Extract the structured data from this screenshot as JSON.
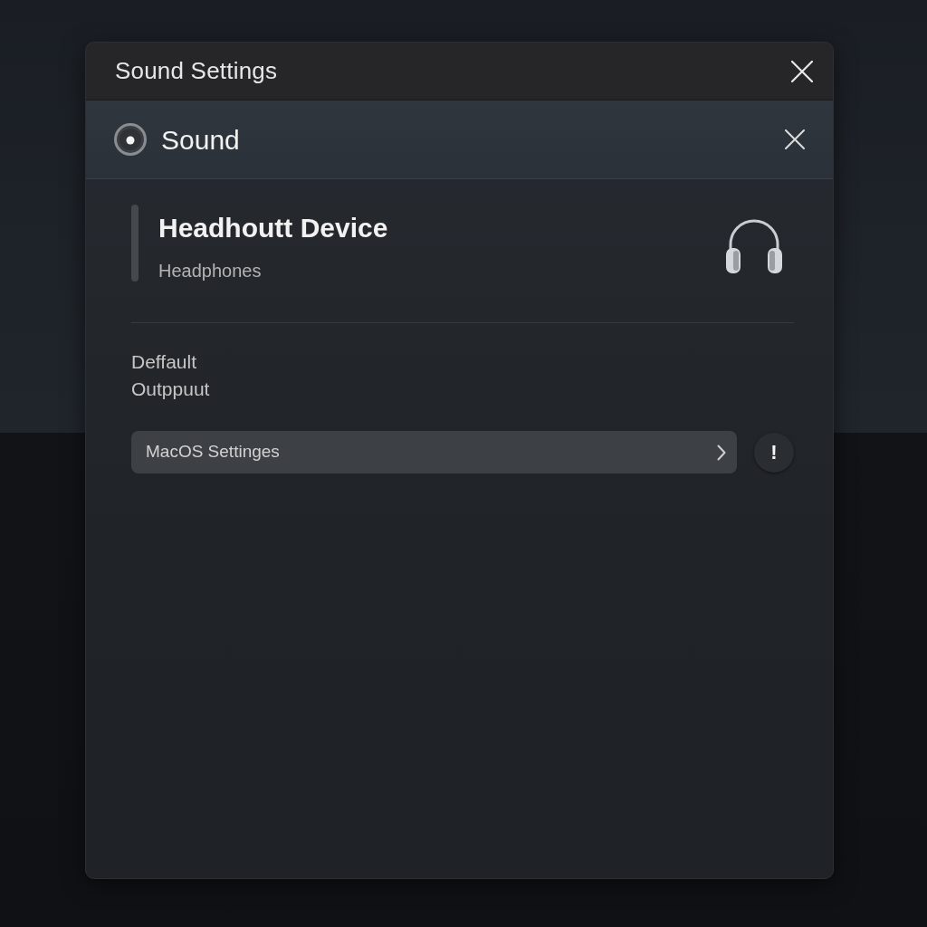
{
  "window": {
    "title": "Sound Settings"
  },
  "panel": {
    "title": "Sound"
  },
  "device": {
    "name": "Headhoutt Device",
    "type": "Headphones"
  },
  "section_label": "Deffault Outppuut",
  "settings_link": {
    "label": "MacOS Settinges"
  },
  "info_button": {
    "label": "!"
  }
}
